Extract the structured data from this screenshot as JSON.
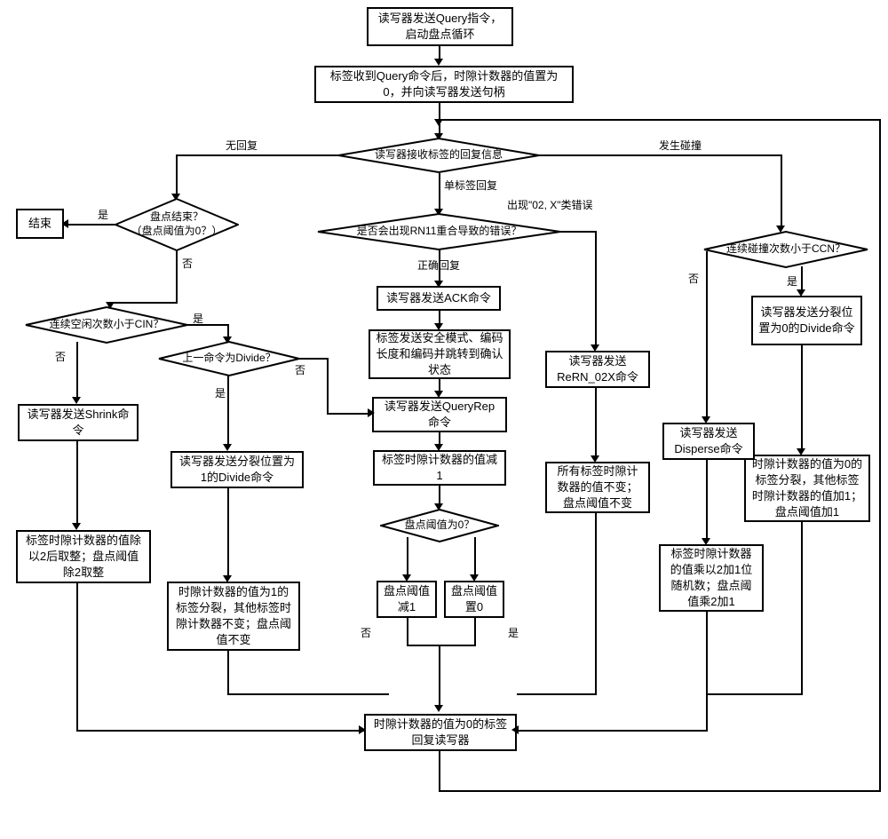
{
  "boxes": {
    "start": "读写器发送Query指令，启动盘点循环",
    "step2": "标签收到Query命令后，时隙计数器的值置为0，并向读写器发送句柄",
    "end": "结束",
    "shrink": "读写器发送Shrink命令",
    "shrink_result": "标签时隙计数器的值除以2后取整；盘点阈值除2取整",
    "divide1": "读写器发送分裂位置为1的Divide命令",
    "divide1_result": "时隙计数器的值为1的标签分裂，其他标签时隙计数器不变；盘点阈值不变",
    "ack": "读写器发送ACK命令",
    "ack_result": "标签发送安全模式、编码长度和编码并跳转到确认状态",
    "queryrep": "读写器发送QueryRep命令",
    "queryrep_result": "标签时隙计数器的值减1",
    "pd_dec": "盘点阈值减1",
    "pd_zero": "盘点阈值置0",
    "rern": "读写器发送ReRN_02X命令",
    "rern_result": "所有标签时隙计数器的值不变；盘点阈值不变",
    "disperse": "读写器发送Disperse命令",
    "disperse_result": "标签时隙计数器的值乘以2加1位随机数；盘点阈值乘2加1",
    "divide0": "读写器发送分裂位置为0的Divide命令",
    "divide0_result": "时隙计数器的值为0的标签分裂，其他标签时隙计数器的值加1；盘点阈值加1",
    "bottom": "时隙计数器的值为0的标签回复读写器"
  },
  "diamonds": {
    "receive": "读写器接收标签的回复信息",
    "pd_end": "盘点结束？\n（盘点阈值为0？）",
    "rn11": "是否会出现RN11重合导致的错误？",
    "cin": "连续空闲次数小于CIN？",
    "prev_divide": "上一命令为Divide？",
    "pd_is_zero": "盘点阈值为0？",
    "ccn": "连续碰撞次数小于CCN？"
  },
  "labels": {
    "no_reply": "无回复",
    "single": "单标签回复",
    "collision": "发生碰撞",
    "yes": "是",
    "no": "否",
    "error_02x": "出现\"02, X\"类错误",
    "correct": "正确回复"
  }
}
